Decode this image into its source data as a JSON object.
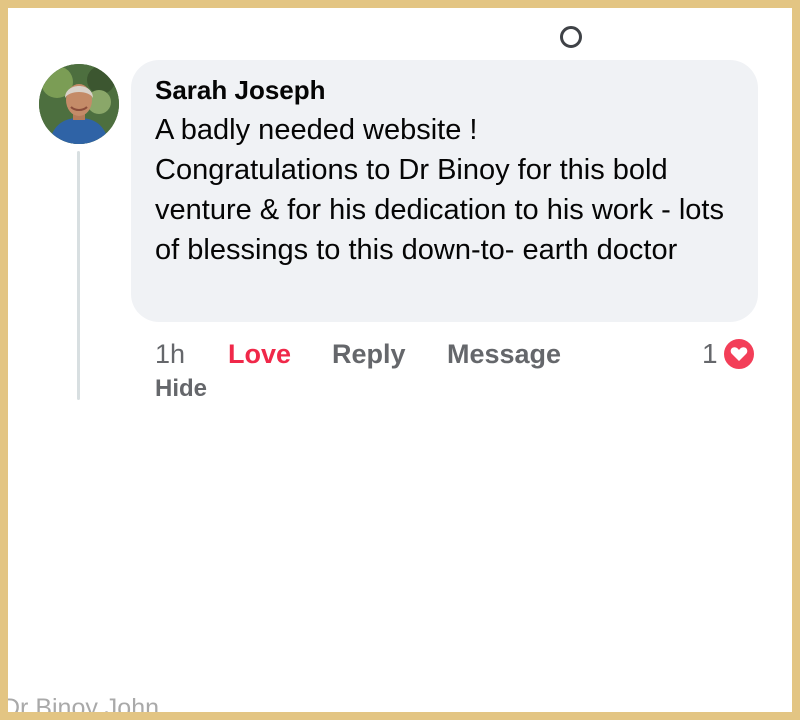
{
  "comment": {
    "author": "Sarah Joseph",
    "text": "A badly needed website !\nCongratulations to Dr Binoy for this bold venture & for his dedication to his work - lots of blessings to this down-to- earth doctor",
    "avatar_icon": "profile-photo"
  },
  "actions": {
    "time": "1h",
    "love": "Love",
    "reply": "Reply",
    "message": "Message",
    "hide": "Hide"
  },
  "reactions": {
    "count": "1",
    "icon": "heart-icon",
    "color": "#f33e58"
  },
  "colors": {
    "frame_border": "#e3c583",
    "bubble_background": "#f0f2f5",
    "love_active": "#f02849",
    "muted_text": "#65676b"
  },
  "watermark": "Dr Binoy John"
}
